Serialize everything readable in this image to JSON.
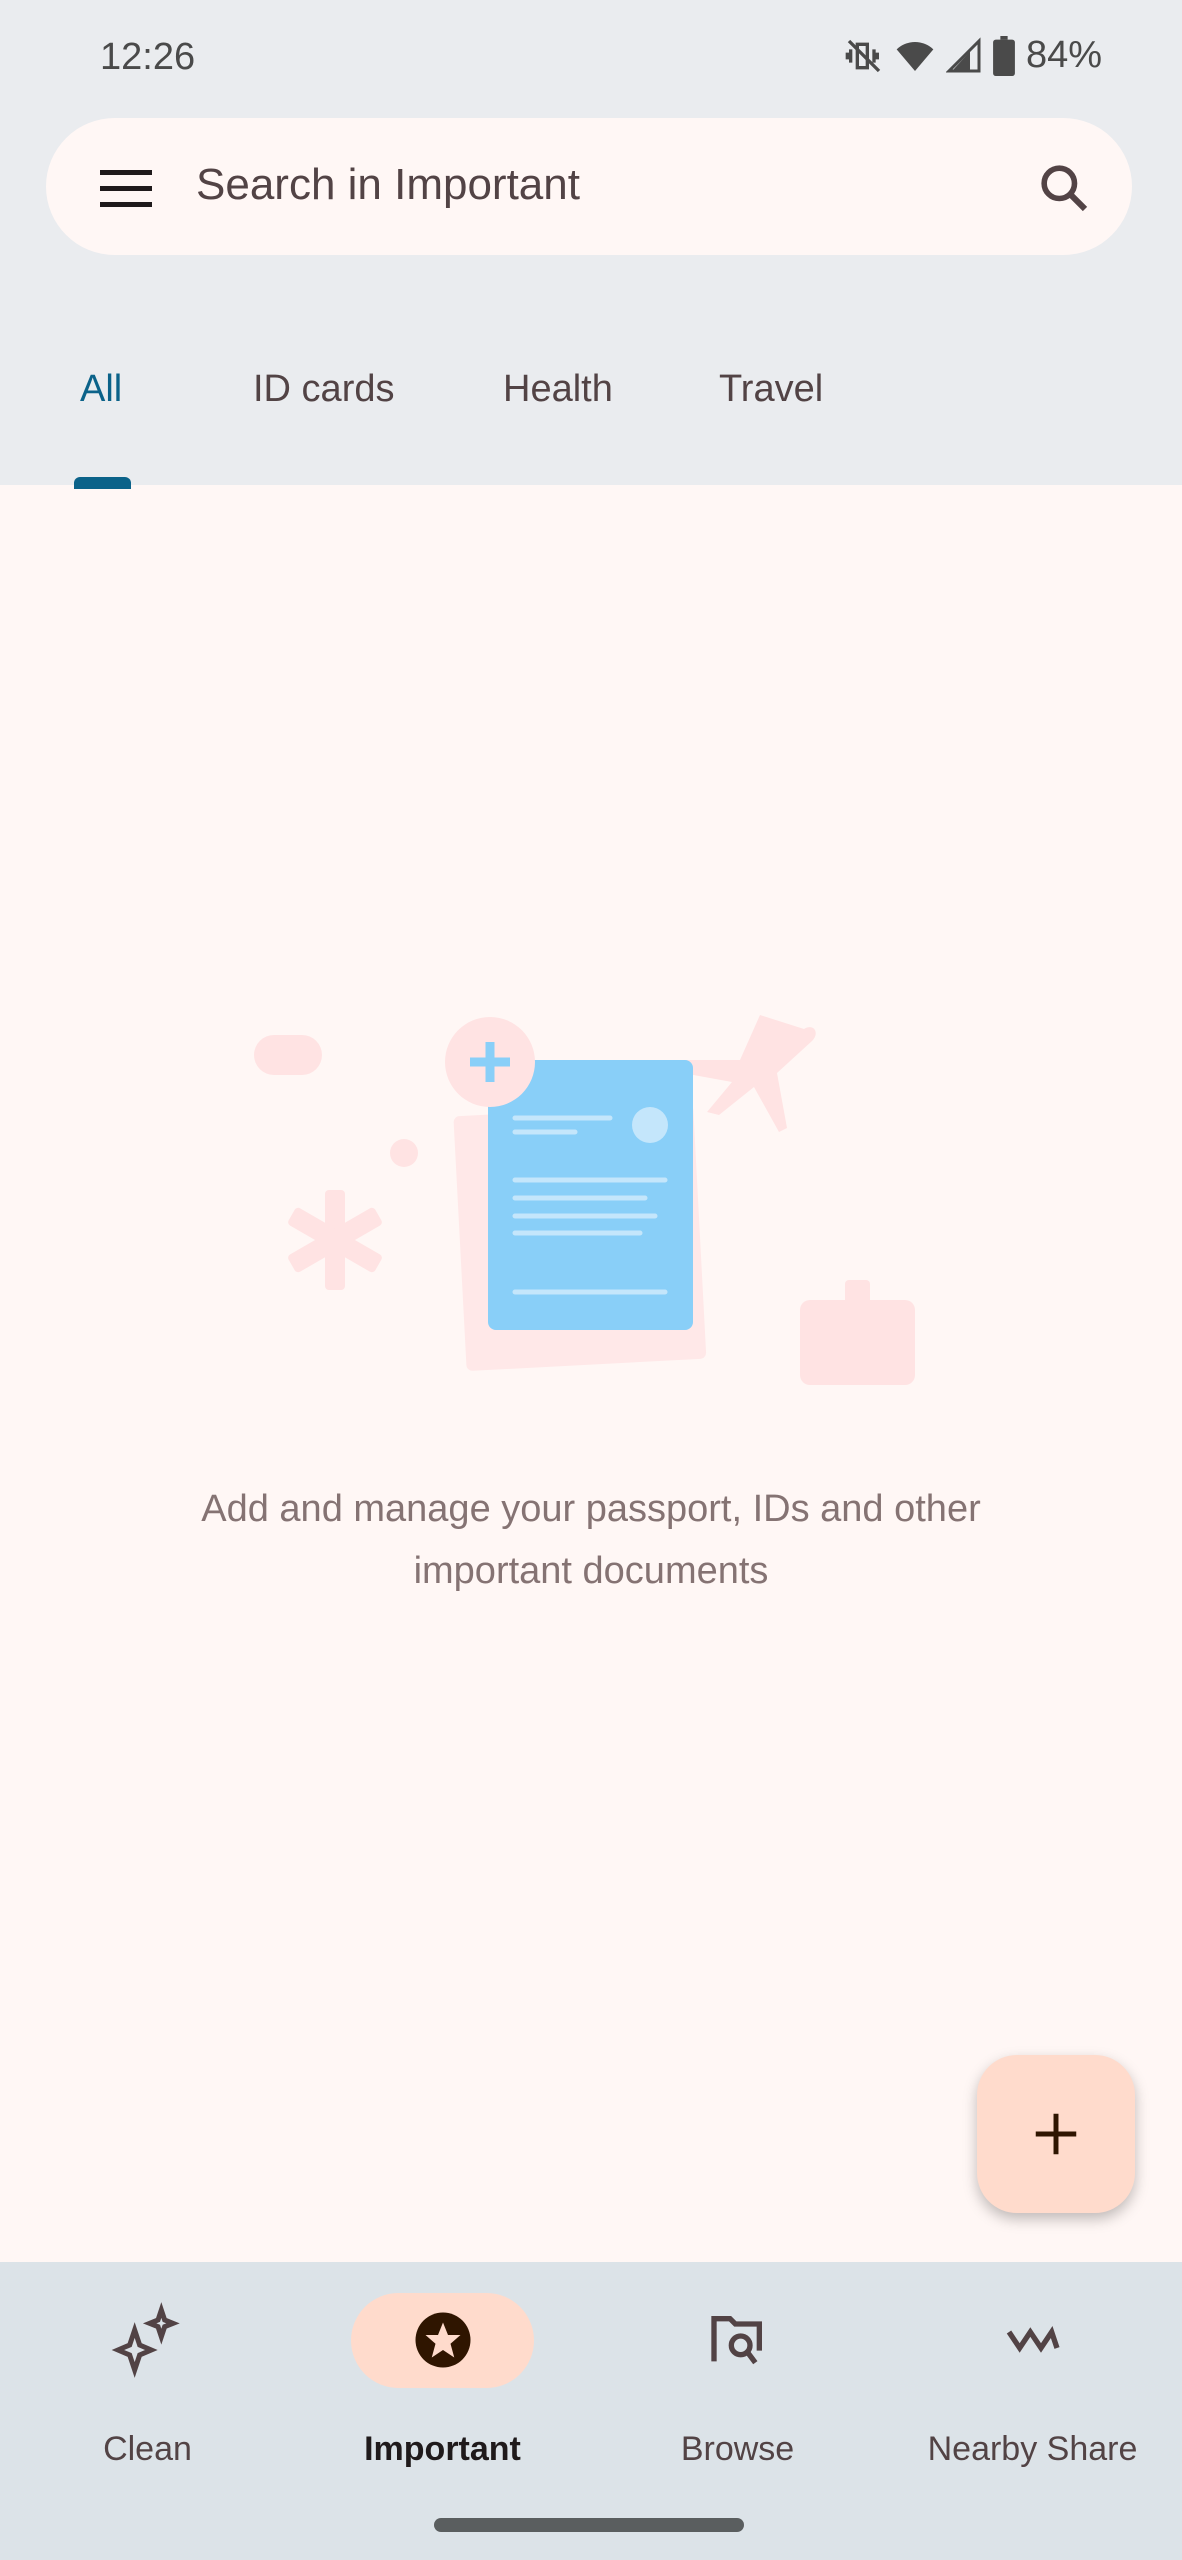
{
  "status_bar": {
    "time": "12:26",
    "battery": "84%",
    "icons": [
      "vibrate-off-icon",
      "wifi-icon",
      "signal-icon",
      "battery-icon"
    ]
  },
  "search": {
    "placeholder": "Search in Important"
  },
  "tabs": [
    {
      "label": "All",
      "selected": true
    },
    {
      "label": "ID cards"
    },
    {
      "label": "Health"
    },
    {
      "label": "Travel"
    }
  ],
  "empty_state": {
    "line1": "Add and manage your passport, IDs and other",
    "line2": "important documents"
  },
  "fab": {
    "icon": "plus-icon"
  },
  "bottom_nav": [
    {
      "label": "Clean",
      "icon": "sparkle-icon"
    },
    {
      "label": "Important",
      "icon": "star-badge-icon",
      "selected": true
    },
    {
      "label": "Browse",
      "icon": "folder-search-icon"
    },
    {
      "label": "Nearby Share",
      "icon": "nearby-share-icon"
    }
  ],
  "colors": {
    "accent": "#0b6289",
    "surface": "#fff7f5",
    "fab": "#ffdbcc",
    "nav": "#dce3e8"
  }
}
